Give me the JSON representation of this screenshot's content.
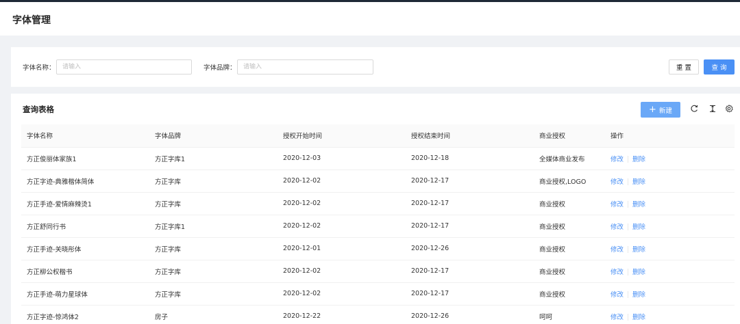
{
  "page": {
    "title": "字体管理"
  },
  "search": {
    "name_label": "字体名称：",
    "name_placeholder": "请输入",
    "brand_label": "字体品牌：",
    "brand_placeholder": "请输入",
    "reset_label": "重 置",
    "query_label": "查 询"
  },
  "table": {
    "title": "查询表格",
    "new_label": "新建",
    "columns": [
      "字体名称",
      "字体品牌",
      "授权开始时间",
      "授权结束时间",
      "商业授权",
      "操作"
    ],
    "actions": {
      "edit": "修改",
      "delete": "删除"
    },
    "rows": [
      {
        "name": "方正俊丽体家族1",
        "brand": "方正字库1",
        "start": "2020-12-03",
        "end": "2020-12-18",
        "license": "全媒体商业发布"
      },
      {
        "name": "方正字迹-典雅楷体简体",
        "brand": "方正字库",
        "start": "2020-12-02",
        "end": "2020-12-17",
        "license": "商业授权,LOGO"
      },
      {
        "name": "方正手迹-爱情麻辣烫1",
        "brand": "方正字库",
        "start": "2020-12-02",
        "end": "2020-12-17",
        "license": "商业授权"
      },
      {
        "name": "方正舒同行书",
        "brand": "方正字库1",
        "start": "2020-12-02",
        "end": "2020-12-17",
        "license": "商业授权"
      },
      {
        "name": "方正手迹-关晓彤体",
        "brand": "方正字库",
        "start": "2020-12-01",
        "end": "2020-12-26",
        "license": "商业授权"
      },
      {
        "name": "方正柳公权楷书",
        "brand": "方正字库",
        "start": "2020-12-02",
        "end": "2020-12-17",
        "license": "商业授权"
      },
      {
        "name": "方正手迹-萌力星球体",
        "brand": "方正字库",
        "start": "2020-12-02",
        "end": "2020-12-17",
        "license": "商业授权"
      },
      {
        "name": "方正字迹-惊鸿体2",
        "brand": "房子",
        "start": "2020-12-22",
        "end": "2020-12-26",
        "license": "呵呵"
      }
    ]
  },
  "colors": {
    "primary": "#4a90f5",
    "background": "#f0f2f5"
  },
  "icons": [
    "plus-icon",
    "reload-icon",
    "column-height-icon",
    "setting-icon"
  ]
}
